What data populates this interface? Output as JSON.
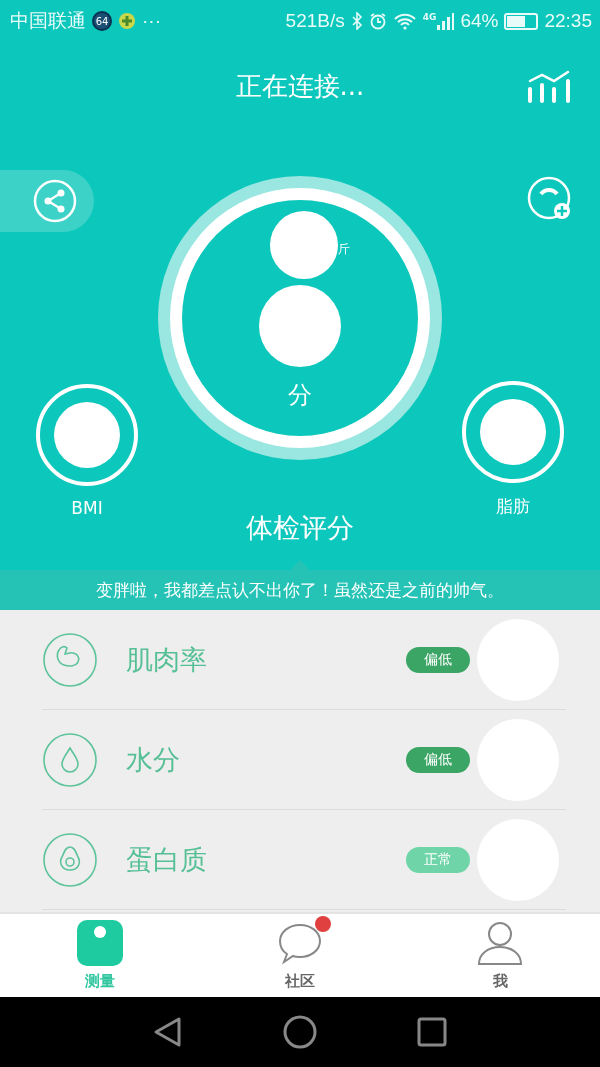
{
  "status_bar": {
    "carrier": "中国联通",
    "sim_badge": "64",
    "more": "···",
    "speed": "521B/s",
    "network": "4G",
    "battery": "64%",
    "time": "22:35"
  },
  "header": {
    "title": "正在连接..."
  },
  "dial": {
    "weight_unit": "斤",
    "score_unit": "分"
  },
  "gauges": [
    {
      "label": "BMI"
    },
    {
      "label": "脂肪"
    }
  ],
  "section_title": "体检评分",
  "message": "变胖啦，我都差点认不出你了！虽然还是之前的帅气。",
  "metrics": [
    {
      "kind": "muscle",
      "name": "肌肉率",
      "status": "偏低",
      "color": "#3aa564"
    },
    {
      "kind": "water",
      "name": "水分",
      "status": "偏低",
      "color": "#3aa564"
    },
    {
      "kind": "protein",
      "name": "蛋白质",
      "status": "正常",
      "color": "#6fd5a8"
    }
  ],
  "tabs": [
    {
      "kind": "measure",
      "label": "测量",
      "selected": true,
      "notification": false
    },
    {
      "kind": "community",
      "label": "社区",
      "selected": false,
      "notification": true
    },
    {
      "kind": "me",
      "label": "我",
      "selected": false,
      "notification": false
    }
  ]
}
